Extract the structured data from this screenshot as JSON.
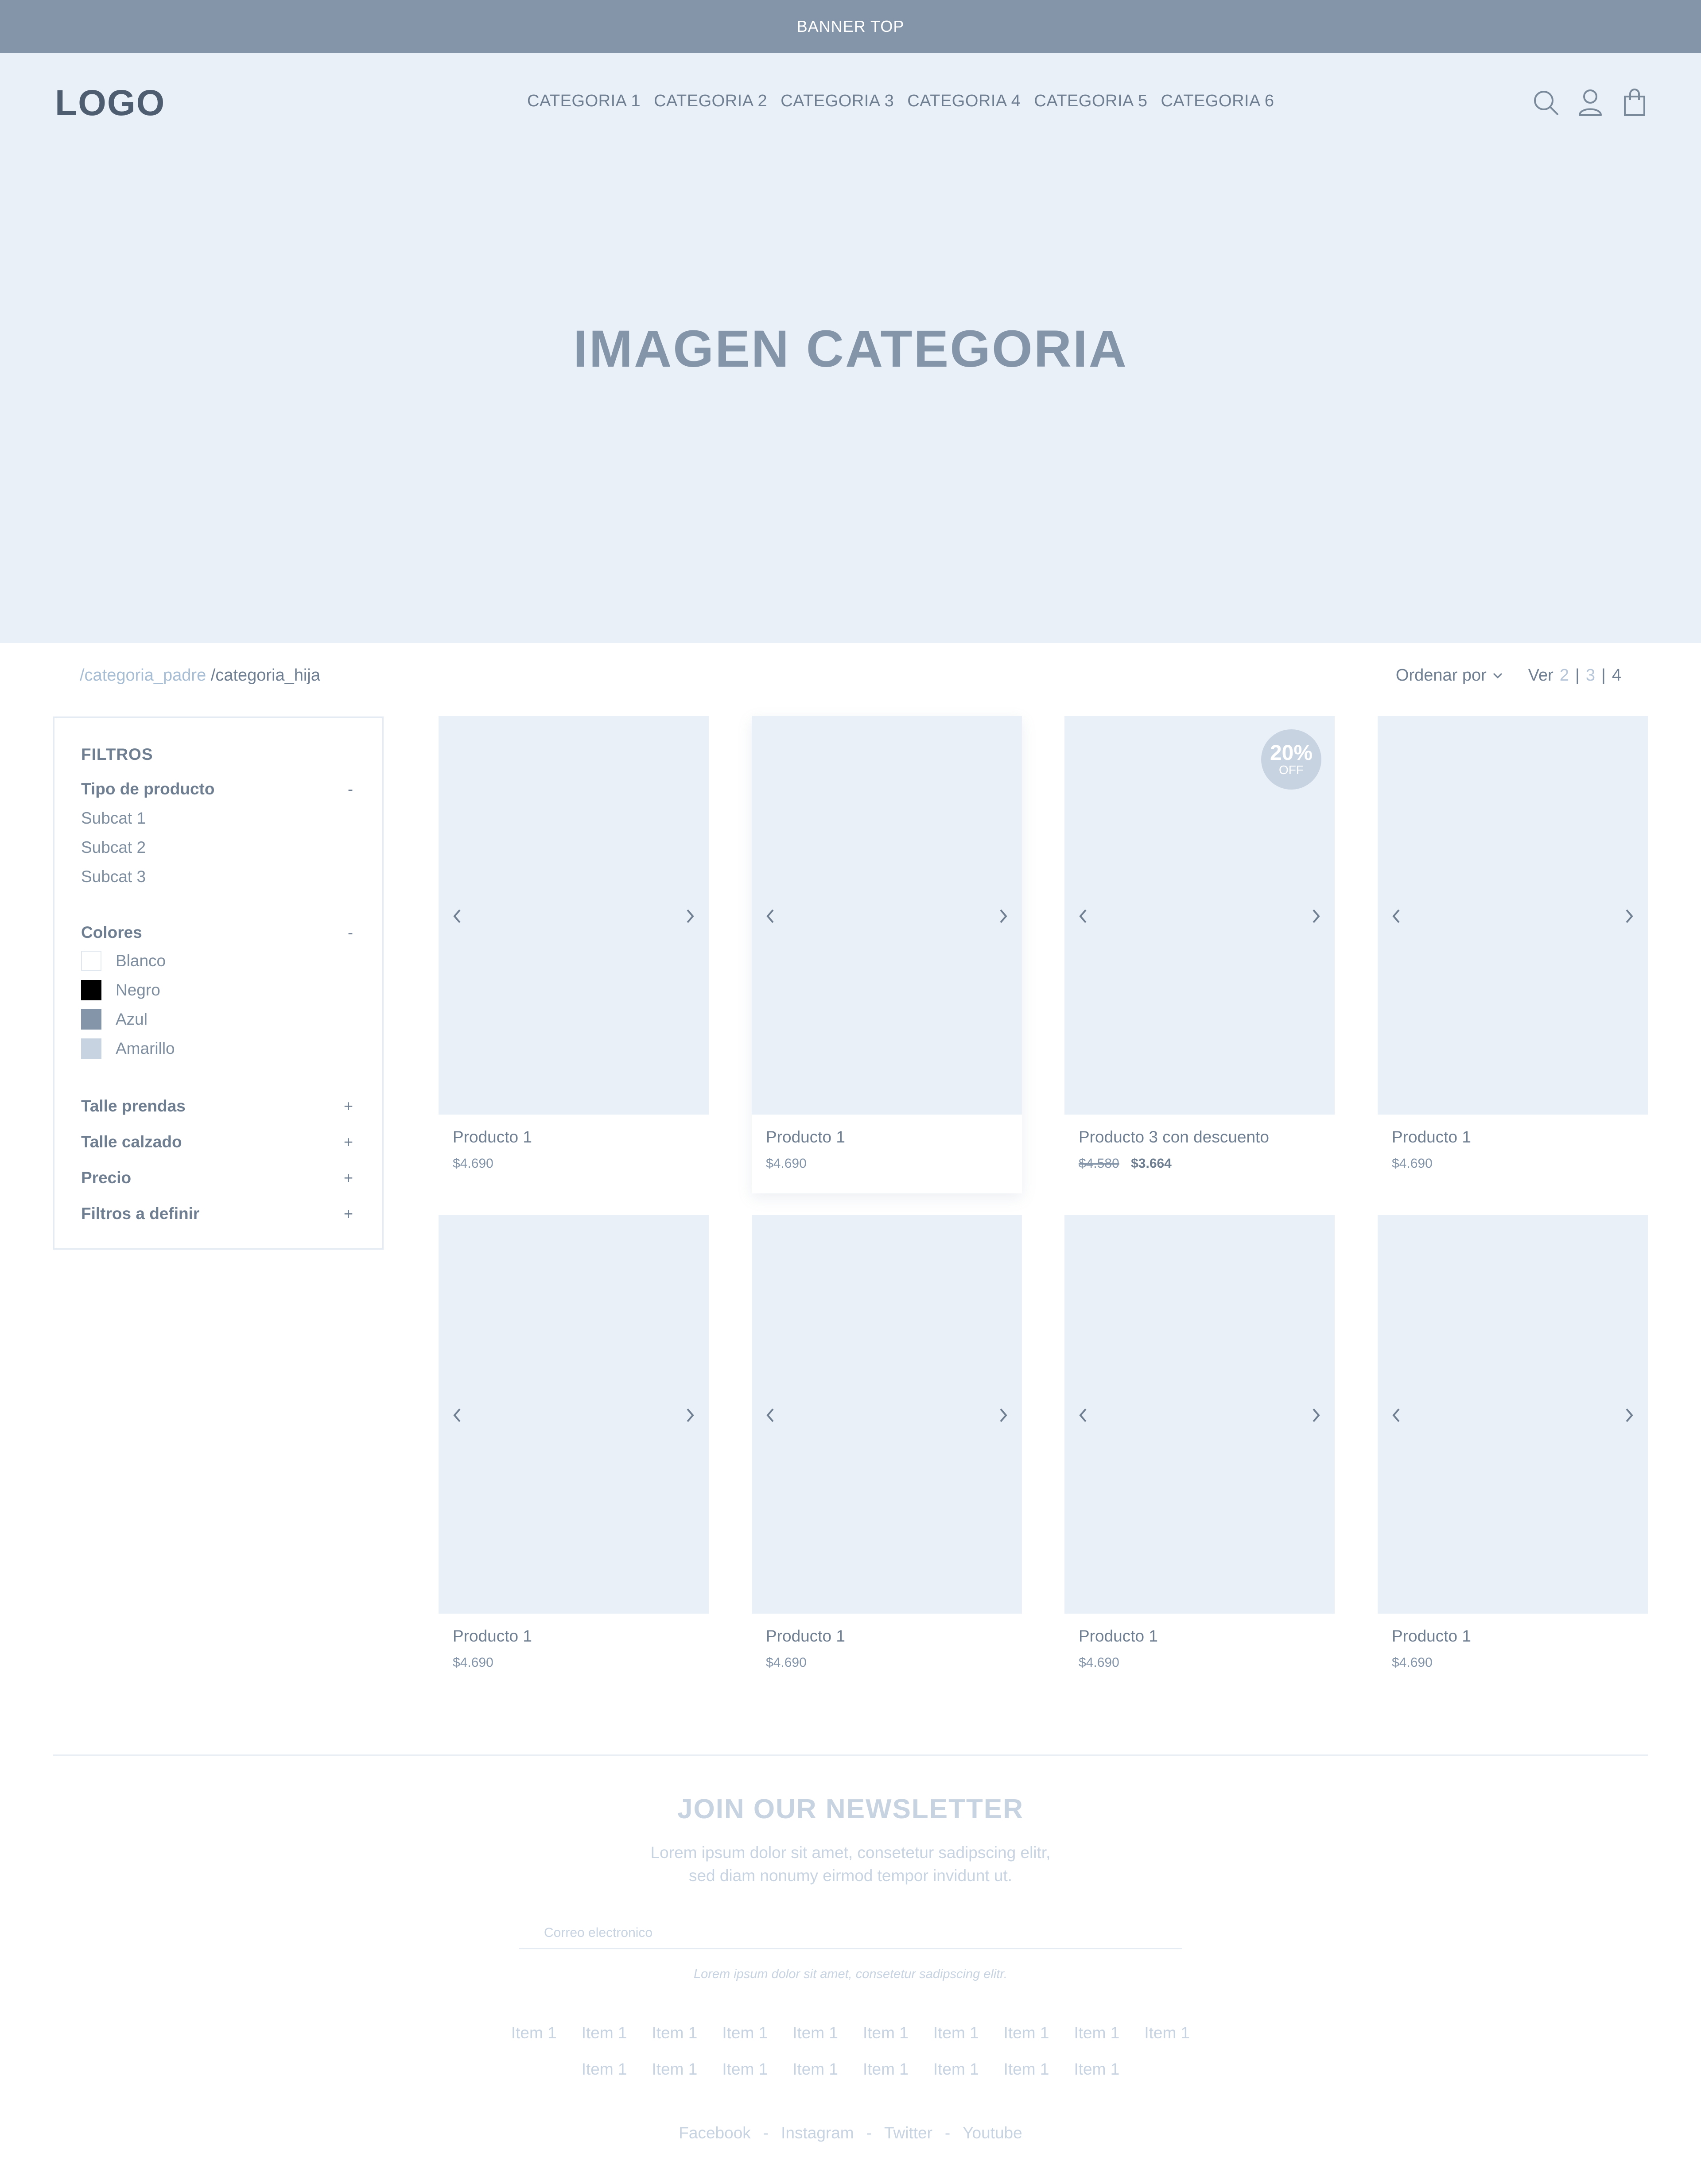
{
  "banner": {
    "text": "BANNER TOP"
  },
  "header": {
    "logo": "LOGO",
    "nav": [
      "CATEGORIA 1",
      "CATEGORIA 2",
      "CATEGORIA 3",
      "CATEGORIA 4",
      "CATEGORIA 5",
      "CATEGORIA 6"
    ],
    "icons": [
      "search-icon",
      "user-icon",
      "bag-icon"
    ]
  },
  "hero": {
    "title": "IMAGEN CATEGORIA"
  },
  "breadcrumb": {
    "parent": "/categoria_padre",
    "child": "/categoria_hija"
  },
  "sort": {
    "label": "Ordenar por",
    "view_label": "Ver",
    "view_options": [
      "2",
      "3",
      "4"
    ],
    "view_active": "4"
  },
  "filters": {
    "title": "FILTROS",
    "tipo": {
      "label": "Tipo de producto",
      "toggle": "-",
      "items": [
        "Subcat 1",
        "Subcat 2",
        "Subcat 3"
      ]
    },
    "colores": {
      "label": "Colores",
      "toggle": "-",
      "items": [
        {
          "name": "Blanco",
          "color": "#ffffff"
        },
        {
          "name": "Negro",
          "color": "#000000"
        },
        {
          "name": "Azul",
          "color": "#8595a9"
        },
        {
          "name": "Amarillo",
          "color": "#c7d3e1"
        }
      ]
    },
    "collapsed": [
      {
        "label": "Talle prendas",
        "toggle": "+"
      },
      {
        "label": "Talle calzado",
        "toggle": "+"
      },
      {
        "label": "Precio",
        "toggle": "+"
      },
      {
        "label": "Filtros a definir",
        "toggle": "+"
      }
    ]
  },
  "products": [
    {
      "name": "Producto 1",
      "price": "$4.690"
    },
    {
      "name": "Producto 1",
      "price": "$4.690"
    },
    {
      "name": "Producto 3 con descuento",
      "old_price": "$4.580",
      "price": "$3.664",
      "badge_pct": "20%",
      "badge_off": "OFF"
    },
    {
      "name": "Producto 1",
      "price": "$4.690"
    },
    {
      "name": "Producto 1",
      "price": "$4.690"
    },
    {
      "name": "Producto 1",
      "price": "$4.690"
    },
    {
      "name": "Producto 1",
      "price": "$4.690"
    },
    {
      "name": "Producto 1",
      "price": "$4.690"
    }
  ],
  "newsletter": {
    "title": "JOIN OUR NEWSLETTER",
    "text": "Lorem ipsum dolor sit amet, consetetur sadipscing elitr, sed diam nonumy eirmod tempor invidunt ut.",
    "placeholder": "Correo electronico",
    "note": "Lorem ipsum dolor sit amet, consetetur sadipscing elitr."
  },
  "footer": {
    "row1": [
      "Item 1",
      "Item 1",
      "Item 1",
      "Item 1",
      "Item 1",
      "Item 1",
      "Item 1",
      "Item 1",
      "Item 1",
      "Item 1"
    ],
    "row2": [
      "Item 1",
      "Item 1",
      "Item 1",
      "Item 1",
      "Item 1",
      "Item 1",
      "Item 1",
      "Item 1"
    ],
    "social": [
      "Facebook",
      "Instagram",
      "Twitter",
      "Youtube"
    ],
    "separator": "-"
  }
}
